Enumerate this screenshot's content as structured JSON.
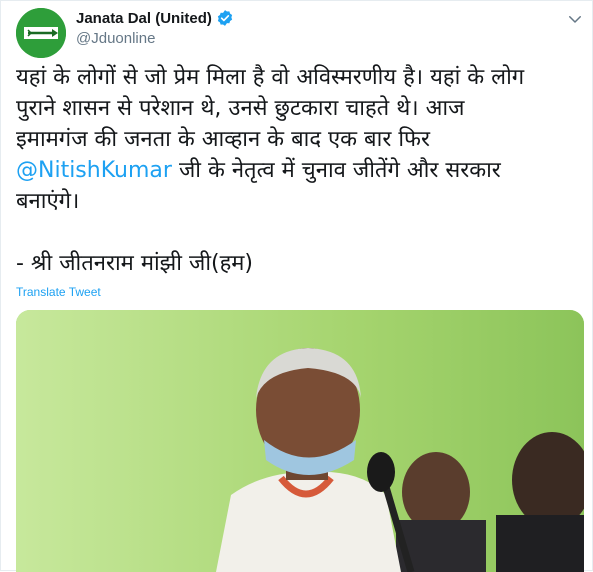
{
  "account": {
    "display_name": "Janata Dal (United)",
    "handle": "@Jduonline",
    "avatar_icon": "party-logo-arrow-icon",
    "verified_icon": "verified-badge-icon",
    "verified_color": "#1da1f2"
  },
  "tweet": {
    "lines": [
      {
        "text": "यहां के लोगों से जो प्रेम मिला है वो अविस्मरणीय है। यहां के लोग"
      },
      {
        "text": "पुराने शासन से परेशान थे, उनसे छुटकारा चाहते थे। आज"
      },
      {
        "text": "इमामगंज की जनता के आव्हान के बाद एक बार फिर"
      }
    ],
    "mention": "@NitishKumar",
    "mention_rest": " जी के नेतृत्व में चुनाव जीतेंगे और सरकार",
    "line_after": "बनाएंगे।",
    "attribution": "- श्री जीतनराम मांझी जी(हम)",
    "translate_label": "Translate Tweet",
    "link_color": "#1da1f2"
  },
  "media": {
    "description_icon": "speaker-photo-image",
    "background_color": "#a7d67a"
  },
  "menu": {
    "icon": "chevron-down-icon"
  }
}
